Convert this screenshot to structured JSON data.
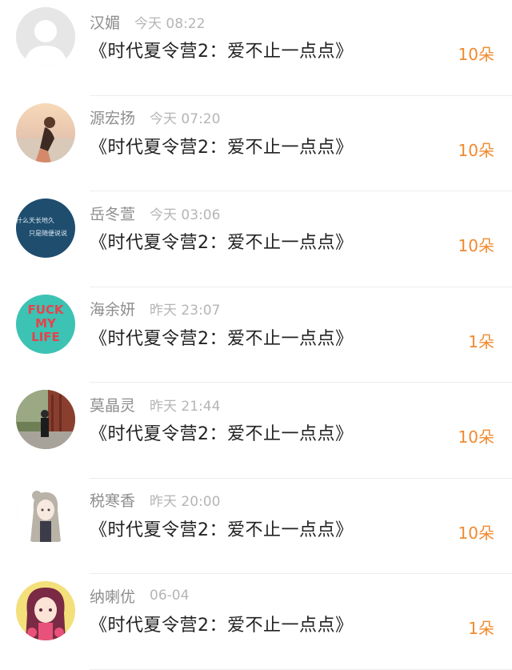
{
  "gift_title": "《时代夏令营2：爱不止一点点》",
  "accent_color": "#f08a2e",
  "rows": [
    {
      "name": "汉媚",
      "time": "今天 08:22",
      "count": "10朵",
      "avatar": "default-avatar-icon"
    },
    {
      "name": "源宏扬",
      "time": "今天 07:20",
      "count": "10朵",
      "avatar": "sunset-girl-photo"
    },
    {
      "name": "岳冬萱",
      "time": "今天 03:06",
      "count": "10朵",
      "avatar": "blue-text-avatar",
      "avatar_text": [
        "什么天长地久",
        "只是随便说说"
      ]
    },
    {
      "name": "海余妍",
      "time": "昨天 23:07",
      "count": "1朵",
      "avatar": "fuck-my-life-avatar",
      "avatar_text": [
        "FUCK",
        "MY",
        "LIFE"
      ]
    },
    {
      "name": "莫晶灵",
      "time": "昨天 21:44",
      "count": "10朵",
      "avatar": "street-photo"
    },
    {
      "name": "税寒香",
      "time": "昨天 20:00",
      "count": "10朵",
      "avatar": "anime-girl-drawing"
    },
    {
      "name": "纳喇优",
      "time": "06-04",
      "count": "1朵",
      "avatar": "anime-girl-pink"
    }
  ]
}
